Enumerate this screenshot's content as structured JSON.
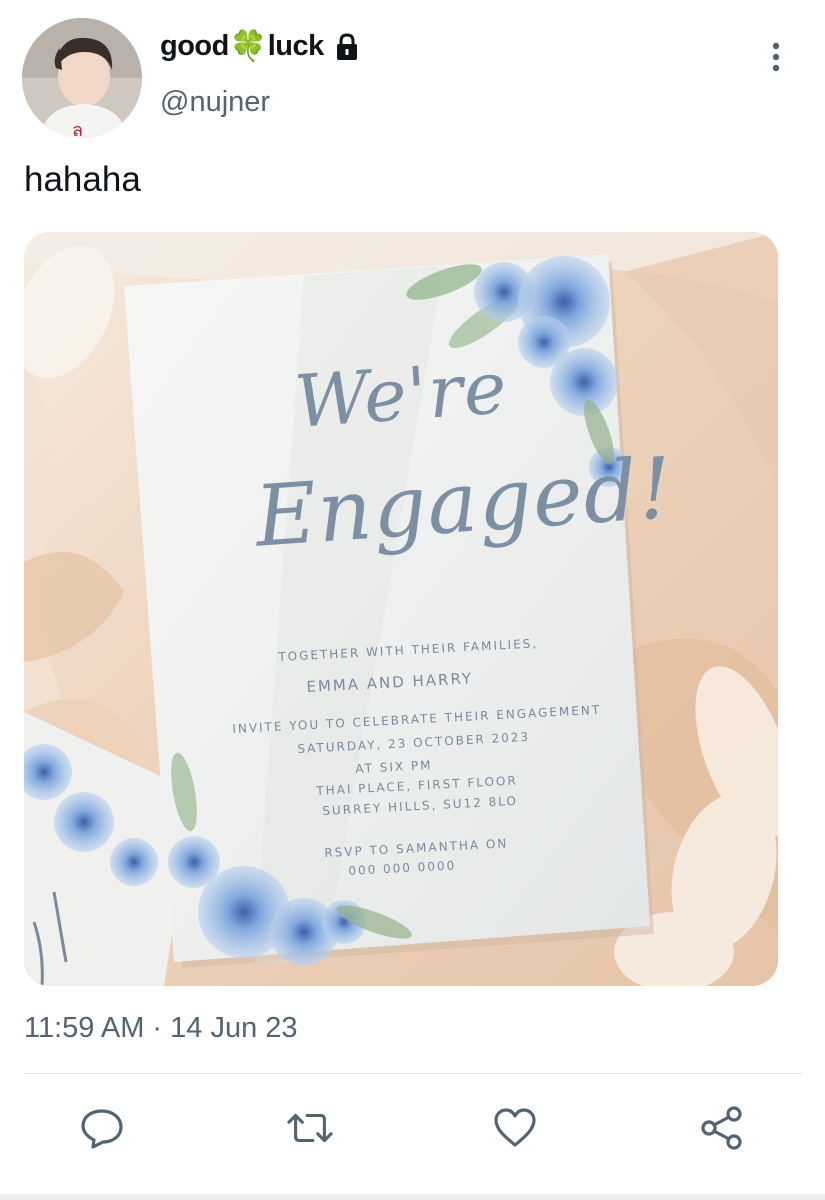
{
  "author": {
    "name_part1": "good",
    "name_emoji": "🍀",
    "name_part2": "luck",
    "handle": "@nujner"
  },
  "tweet": {
    "text": "hahaha",
    "timestamp": "11:59 AM · 14 Jun 23"
  },
  "invitation": {
    "script_line1": "We're",
    "script_line2": "Engaged!",
    "together": "TOGETHER WITH THEIR FAMILIES,",
    "names": "EMMA AND HARRY",
    "invite": "INVITE YOU TO CELEBRATE THEIR ENGAGEMENT",
    "date": "SATURDAY, 23 OCTOBER 2023",
    "time": "AT SIX PM",
    "venue": "THAI PLACE, FIRST FLOOR",
    "address": "SURREY HILLS, SU12 8LO",
    "rsvp": "RSVP TO SAMANTHA ON",
    "phone": "000 000 0000"
  },
  "actions": {
    "reply": "reply-icon",
    "retweet": "retweet-icon",
    "like": "heart-icon",
    "share": "share-icon"
  },
  "colors": {
    "text_primary": "#0f1419",
    "text_secondary": "#536471",
    "icon": "#536471",
    "clover": "#4cae3f",
    "invite_ink": "#7b8a9a",
    "flowers": "#6f9bd6"
  }
}
